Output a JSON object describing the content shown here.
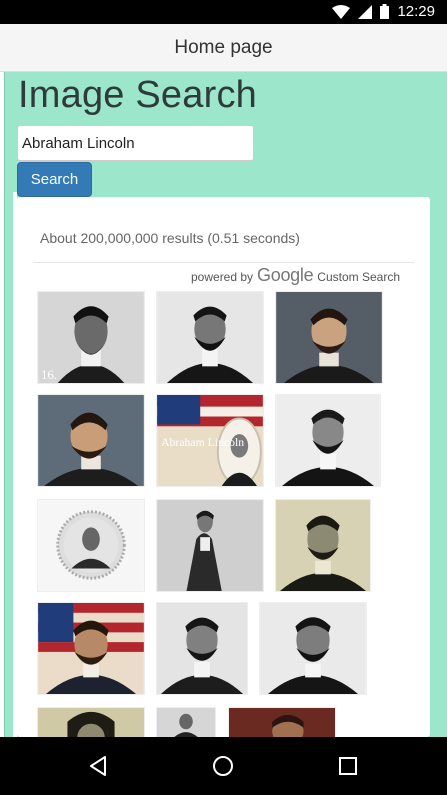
{
  "status_bar": {
    "time": "12:29",
    "icons": [
      "wifi-icon",
      "signal-icon",
      "battery-icon"
    ]
  },
  "app_bar": {
    "title": "Home page"
  },
  "page": {
    "heading": "Image Search"
  },
  "search": {
    "value": "Abraham Lincoln",
    "button_label": "Search"
  },
  "results": {
    "stats": "About 200,000,000 results (0.51 seconds)",
    "powered_by_label": "powered by",
    "google_label": "Google",
    "custom_search_label": "Custom Search",
    "thumbnails": [
      {
        "caption": "16."
      },
      {
        "caption": ""
      },
      {
        "caption": ""
      },
      {
        "caption": ""
      },
      {
        "caption": "Abraham Lincoln"
      },
      {
        "caption": ""
      },
      {
        "caption": ""
      },
      {
        "caption": ""
      },
      {
        "caption": ""
      },
      {
        "caption": ""
      },
      {
        "caption": ""
      },
      {
        "caption": ""
      },
      {
        "caption": ""
      },
      {
        "caption": ""
      },
      {
        "caption": ""
      }
    ]
  },
  "nav": {
    "buttons": [
      "back-icon",
      "home-icon",
      "recents-icon"
    ]
  },
  "colors": {
    "accent": "#337ab7",
    "frame": "#9ce6cc",
    "app_bar": "#f5f5f5"
  }
}
